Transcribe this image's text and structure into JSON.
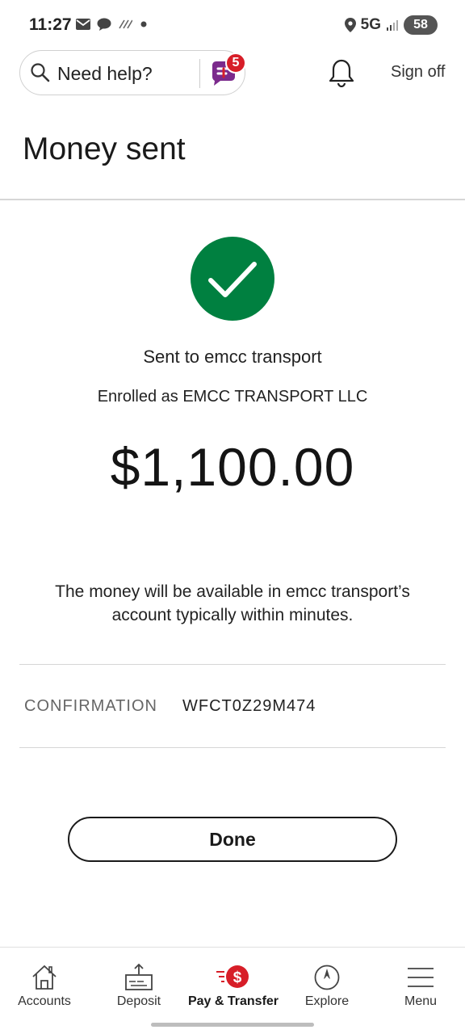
{
  "status_bar": {
    "time": "11:27",
    "network": "5G",
    "battery": "58",
    "icons_left": [
      "mail-icon",
      "chat-bubble-icon",
      "signal-noise-icon",
      "dot-icon"
    ],
    "icons_right": [
      "location-icon",
      "signal-bars-icon",
      "battery-icon"
    ]
  },
  "header": {
    "help_label": "Need help?",
    "chat_badge": "5",
    "sign_off_label": "Sign off",
    "icons": [
      "search-icon",
      "chat-assistant-icon",
      "bell-icon"
    ]
  },
  "page": {
    "title": "Money sent"
  },
  "confirmation_panel": {
    "status_icon": "checkmark-icon",
    "sent_to": "Sent to emcc transport",
    "enrolled_as": "Enrolled as EMCC TRANSPORT LLC",
    "amount": "$1,100.00",
    "availability_text": "The money will be available in emcc transport’s account typically within minutes.",
    "confirmation_label": "CONFIRMATION",
    "confirmation_number": "WFCT0Z29M474",
    "done_label": "Done"
  },
  "colors": {
    "success_green": "#008040",
    "brand_red": "#d71e28",
    "chat_purple": "#7b2a8c"
  },
  "bottom_nav": {
    "items": [
      {
        "label": "Accounts",
        "icon": "home-icon",
        "active": false
      },
      {
        "label": "Deposit",
        "icon": "deposit-icon",
        "active": false
      },
      {
        "label": "Pay & Transfer",
        "icon": "pay-transfer-icon",
        "active": true
      },
      {
        "label": "Explore",
        "icon": "compass-icon",
        "active": false
      },
      {
        "label": "Menu",
        "icon": "hamburger-menu-icon",
        "active": false
      }
    ]
  }
}
